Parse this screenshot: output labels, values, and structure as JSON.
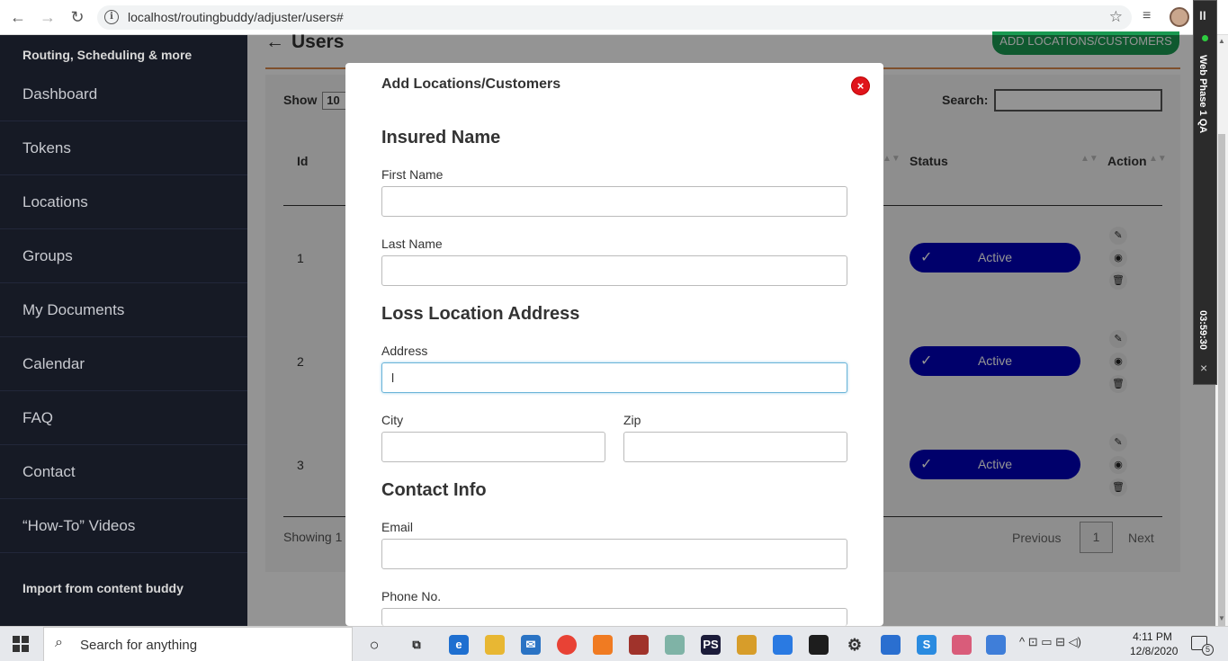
{
  "browser": {
    "url": "localhost/routingbuddy/adjuster/users#",
    "back_icon": "←",
    "forward_icon": "→",
    "reload_icon": "↻",
    "info_icon": "i",
    "star_icon": "☆",
    "playlist_icon": "≡"
  },
  "sidebar": {
    "brand": "Routing, Scheduling & more",
    "items": [
      {
        "label": "Dashboard"
      },
      {
        "label": "Tokens"
      },
      {
        "label": "Locations"
      },
      {
        "label": "Groups"
      },
      {
        "label": "My Documents"
      },
      {
        "label": "Calendar"
      },
      {
        "label": "FAQ"
      },
      {
        "label": "Contact"
      },
      {
        "label": "“How-To” Videos"
      }
    ],
    "import_label": "Import from content buddy"
  },
  "page": {
    "title": "Users",
    "back_arrow": "←",
    "add_button": "ADD LOCATIONS/CUSTOMERS",
    "show_label": "Show",
    "show_value": "10",
    "search_label": "Search:",
    "columns": {
      "id": "Id",
      "status": "Status",
      "action": "Action"
    },
    "rows": [
      {
        "id": "1",
        "status": "Active"
      },
      {
        "id": "2",
        "status": "Active"
      },
      {
        "id": "3",
        "status": "Active"
      }
    ],
    "check_icon": "✓",
    "edit_icon": "✎",
    "view_icon": "◉",
    "delete_icon": "🗑",
    "showing_text": "Showing 1",
    "previous": "Previous",
    "page_number": "1",
    "next": "Next"
  },
  "modal": {
    "title": "Add Locations/Customers",
    "close_icon": "×",
    "insured_section": "Insured Name",
    "first_name_label": "First Name",
    "first_name_value": "",
    "last_name_label": "Last Name",
    "last_name_value": "",
    "loss_section": "Loss Location Address",
    "address_label": "Address",
    "address_value": "l",
    "city_label": "City",
    "city_value": "",
    "zip_label": "Zip",
    "zip_value": "",
    "contact_section": "Contact Info",
    "email_label": "Email",
    "email_value": "",
    "phone_label": "Phone No.",
    "phone_value": ""
  },
  "recorder": {
    "pause_icon": "II",
    "label": "Web Phase 1 QA",
    "timer": "03:59:30",
    "close_icon": "×"
  },
  "taskbar": {
    "search_placeholder": "Search for anything",
    "search_icon": "⌕",
    "time": "4:11 PM",
    "date": "12/8/2020",
    "notification_count": "5",
    "tray_icons": "^ ⊡ ▭ ⊟ ◁)"
  },
  "colors": {
    "sidebar_bg": "#161a25",
    "accent_green": "#1a9a52",
    "status_blue": "#0000b8",
    "close_red": "#e0141b",
    "divider_orange": "#d98b4f"
  }
}
